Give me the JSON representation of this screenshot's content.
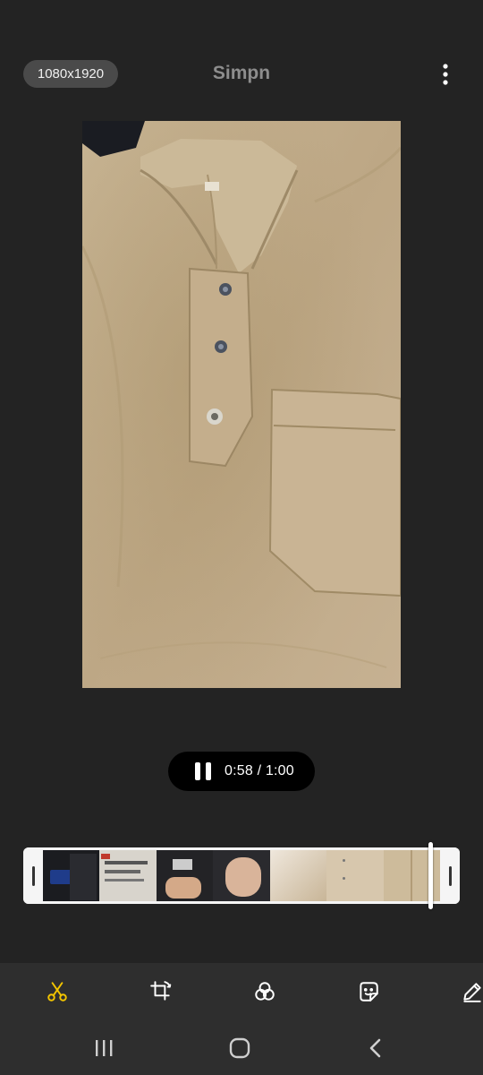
{
  "header": {
    "resolution": "1080x1920",
    "title": "Simpn",
    "more_icon": "more-vertical-icon"
  },
  "preview": {
    "subject": "beige shirt video frame"
  },
  "playback": {
    "state_icon": "pause-icon",
    "time": "0:58 / 1:00",
    "progress_fraction": 0.967
  },
  "timeline": {
    "frame_count": 7
  },
  "toolbar": {
    "tools": [
      {
        "name": "trim",
        "icon": "scissors-icon",
        "active": true
      },
      {
        "name": "crop",
        "icon": "crop-rotate-icon",
        "active": false
      },
      {
        "name": "filter",
        "icon": "filter-icon",
        "active": false
      },
      {
        "name": "sticker",
        "icon": "sticker-icon",
        "active": false
      },
      {
        "name": "draw",
        "icon": "pen-icon",
        "active": false
      }
    ],
    "active_color": "#f2c400"
  },
  "navbar": {
    "recents_icon": "recents-icon",
    "home_icon": "home-icon",
    "back_icon": "back-icon"
  }
}
